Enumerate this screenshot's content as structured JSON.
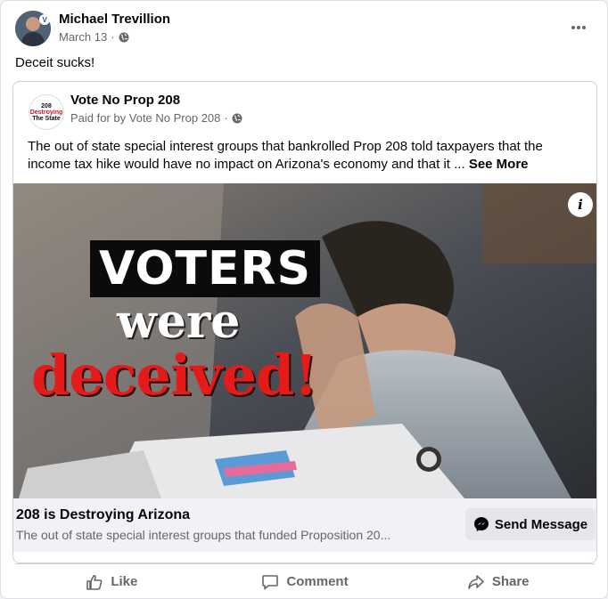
{
  "post": {
    "author": "Michael Trevillion",
    "date": "March 13",
    "separator": "·",
    "more_icon": "more-horizontal-icon",
    "text": "Deceit sucks!"
  },
  "ad": {
    "page_name": "Vote No Prop 208",
    "paid_by": "Paid for by Vote No Prop 208",
    "separator": "·",
    "avatar_lines": [
      "208",
      "Destroying",
      "The State"
    ],
    "body": "The out of state special interest groups that bankrolled Prop 208 told taxpayers that the income tax hike would have no impact on Arizona's economy and that it ... ",
    "see_more": "See More",
    "image": {
      "line1": "VOTERS",
      "line2": "were",
      "line3": "deceived!",
      "info_label": "i"
    },
    "footer_title": "208 is Destroying Arizona",
    "footer_desc": "The out of state special interest groups that funded Proposition 20...",
    "cta_label": "Send Message"
  },
  "actions": {
    "like": "Like",
    "comment": "Comment",
    "share": "Share"
  },
  "colors": {
    "accent_red": "#e31b1b",
    "text_secondary": "#65676b",
    "button_bg": "#e4e6eb"
  }
}
